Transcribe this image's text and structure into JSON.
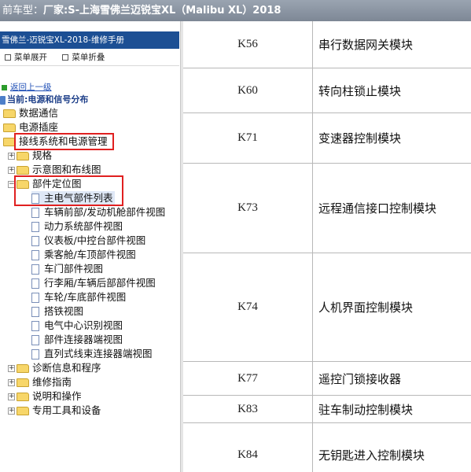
{
  "topbar": {
    "label": "前车型：",
    "value": "厂家:S-上海雪佛兰迈锐宝XL（Malibu XL）2018"
  },
  "sidebar": {
    "header": "雪佛兰-迈锐宝XL-2018-维修手册",
    "tools": [
      "菜单展开",
      "菜单折叠"
    ],
    "back_link": "返回上一级",
    "current": "当前:电源和信号分布",
    "tree": [
      {
        "label": "数据通信"
      },
      {
        "label": "电源插座"
      },
      {
        "label": "接线系统和电源管理"
      },
      {
        "label": "规格"
      },
      {
        "label": "示意图和布线图"
      },
      {
        "label": "部件定位图"
      },
      {
        "label": "主电气部件列表"
      },
      {
        "label": "车辆前部/发动机舱部件视图"
      },
      {
        "label": "动力系统部件视图"
      },
      {
        "label": "仪表板/中控台部件视图"
      },
      {
        "label": "乘客舱/车顶部件视图"
      },
      {
        "label": "车门部件视图"
      },
      {
        "label": "行李厢/车辆后部部件视图"
      },
      {
        "label": "车轮/车底部件视图"
      },
      {
        "label": "搭铁视图"
      },
      {
        "label": "电气中心识别视图"
      },
      {
        "label": "部件连接器端视图"
      },
      {
        "label": "直列式线束连接器端视图"
      },
      {
        "label": "诊断信息和程序"
      },
      {
        "label": "维修指南"
      },
      {
        "label": "说明和操作"
      },
      {
        "label": "专用工具和设备"
      }
    ]
  },
  "table": {
    "rows": [
      {
        "code": "K56",
        "name": "串行数据网关模块"
      },
      {
        "code": "K60",
        "name": "转向柱锁止模块"
      },
      {
        "code": "K71",
        "name": "变速器控制模块"
      },
      {
        "code": "K73",
        "name": "远程通信接口控制模块"
      },
      {
        "code": "K74",
        "name": "人机界面控制模块"
      },
      {
        "code": "K77",
        "name": "遥控门锁接收器"
      },
      {
        "code": "K83",
        "name": "驻车制动控制模块"
      },
      {
        "code": "K84",
        "name": "无钥匙进入控制模块"
      }
    ]
  },
  "colors": {
    "highlight": "#e02020",
    "header_blue": "#1c4f94",
    "link_blue": "#1f4fb6"
  }
}
